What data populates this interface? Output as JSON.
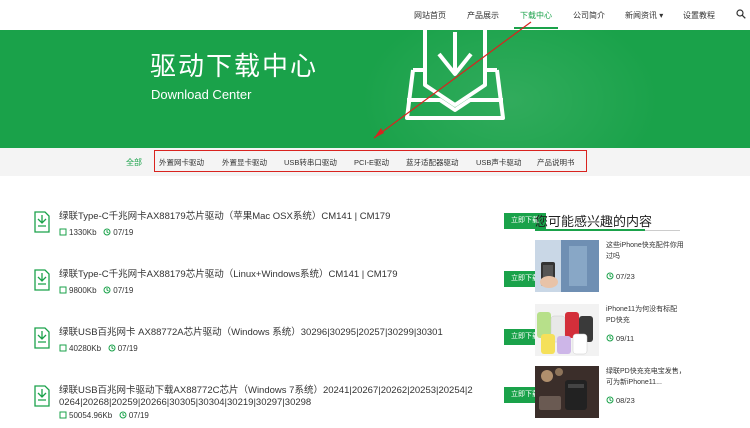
{
  "nav": {
    "items": [
      "网站首页",
      "产品展示",
      "下载中心",
      "公司简介",
      "新闻资讯 ▾",
      "设置教程"
    ],
    "active_index": 2
  },
  "banner": {
    "title": "驱动下载中心",
    "subtitle": "Download Center"
  },
  "categories": {
    "all": "全部",
    "items": [
      "外置网卡驱动",
      "外置显卡驱动",
      "USB转串口驱动",
      "PCI-E驱动",
      "蓝牙适配器驱动",
      "USB声卡驱动",
      "产品说明书"
    ]
  },
  "downloads": [
    {
      "title": "绿联Type-C千兆网卡AX88179芯片驱动（苹果Mac OSX系统）CM141 | CM179",
      "size": "1330Kb",
      "date": "07/19",
      "button": "立即下载"
    },
    {
      "title": "绿联Type-C千兆网卡AX88179芯片驱动（Linux+Windows系统）CM141 | CM179",
      "size": "9800Kb",
      "date": "07/19",
      "button": "立即下载"
    },
    {
      "title": "绿联USB百兆网卡 AX88772A芯片驱动（Windows 系统）30296|30295|20257|30299|30301",
      "size": "40280Kb",
      "date": "07/19",
      "button": "立即下载"
    },
    {
      "title": "绿联USB百兆网卡驱动下载AX88772C芯片（Windows 7系统）20241|20267|20262|20253|20254|20264|20268|20259|20266|30305|30304|30219|30297|30298",
      "size": "50054.96Kb",
      "date": "07/19",
      "button": "立即下载"
    }
  ],
  "sidebar": {
    "title": "您可能感兴趣的内容",
    "items": [
      {
        "text": "这些iPhone快充配件你用过吗",
        "date": "07/23"
      },
      {
        "text": "iPhone11为何没有标配PD快充",
        "date": "09/11"
      },
      {
        "text": "绿联PD快充充电宝发售，可为新iPhone11...",
        "date": "08/23"
      }
    ]
  },
  "colors": {
    "brand_green": "#1aa24a",
    "annotation_red": "#d9231f"
  }
}
